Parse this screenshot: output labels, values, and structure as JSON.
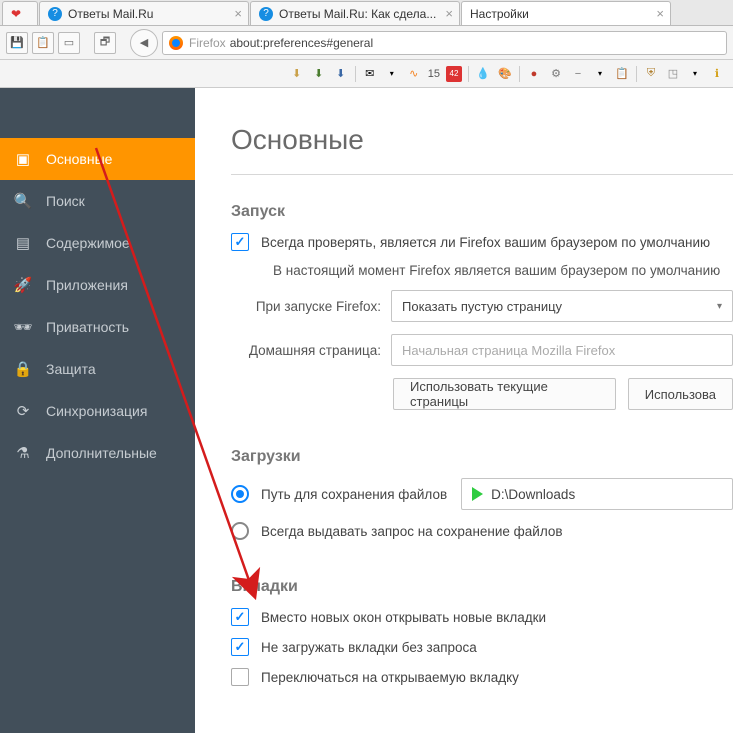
{
  "tabs": [
    {
      "label": "Ответы Mail.Ru",
      "icon": "mailru"
    },
    {
      "label": "Ответы Mail.Ru: Как сдела...",
      "icon": "mailru"
    },
    {
      "label": "Настройки",
      "icon": "none",
      "active": true
    }
  ],
  "urlbar": {
    "identity": "Firefox",
    "url": "about:preferences#general"
  },
  "extbar": {
    "count": "15"
  },
  "sidebar": [
    {
      "key": "general",
      "label": "Основные",
      "active": true,
      "icon": "◧"
    },
    {
      "key": "search",
      "label": "Поиск",
      "icon": "🔍"
    },
    {
      "key": "content",
      "label": "Содержимое",
      "icon": "≣"
    },
    {
      "key": "apps",
      "label": "Приложения",
      "icon": "🚀"
    },
    {
      "key": "privacy",
      "label": "Приватность",
      "icon": "🕶"
    },
    {
      "key": "security",
      "label": "Защита",
      "icon": "🔒"
    },
    {
      "key": "sync",
      "label": "Синхронизация",
      "icon": "⟳"
    },
    {
      "key": "advanced",
      "label": "Дополнительные",
      "icon": "⚗"
    }
  ],
  "page": {
    "title": "Основные",
    "startup": {
      "heading": "Запуск",
      "default_check": "Всегда проверять, является ли Firefox вашим браузером по умолчанию",
      "default_status": "В настоящий момент Firefox является вашим браузером по умолчанию",
      "on_start_label": "При запуске Firefox:",
      "on_start_value": "Показать пустую страницу",
      "home_label": "Домашняя страница:",
      "home_placeholder": "Начальная страница Mozilla Firefox",
      "btn_current": "Использовать текущие страницы",
      "btn_bookmark": "Использова"
    },
    "downloads": {
      "heading": "Загрузки",
      "opt_path": "Путь для сохранения файлов",
      "path": "D:\\Downloads",
      "opt_ask": "Всегда выдавать запрос на сохранение файлов"
    },
    "tabs_section": {
      "heading": "Вкладки",
      "cb1": "Вместо новых окон открывать новые вкладки",
      "cb2": "Не загружать вкладки без запроса",
      "cb3": "Переключаться на открываемую вкладку"
    }
  }
}
